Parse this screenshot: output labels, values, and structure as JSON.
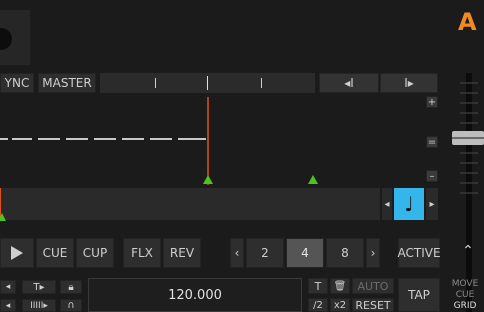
{
  "deck": {
    "letter": "A"
  },
  "top_row": {
    "sync_label": "YNC",
    "master_label": "MASTER"
  },
  "beatjump": {
    "back_glyph": "◂I",
    "fwd_glyph": "I▸"
  },
  "side": {
    "plus": "+",
    "equal": "=",
    "minus": "–"
  },
  "grid": {
    "prev": "◂",
    "next": "▸",
    "note_glyph": "♩"
  },
  "transport": {
    "cue_label": "CUE",
    "cup_label": "CUP",
    "flx_label": "FLX",
    "rev_label": "REV",
    "loop_prev": "‹",
    "loop_next": "›",
    "loop_values": [
      "2",
      "4",
      "8"
    ],
    "loop_selected": "4",
    "active_label": "ACTIVE",
    "expand_glyph": "⌃"
  },
  "bottom": {
    "bpm_value": "120.000",
    "half_label": "/2",
    "double_label": "x2",
    "auto_label": "AUTO",
    "reset_label": "RESET",
    "tap_label": "TAP",
    "move_line1": "MOVE",
    "move_line2": "CUE",
    "move_line3": "GRID"
  },
  "colors": {
    "accent": "#f08a24",
    "playhead": "#e0521c",
    "cue_marker": "#4cc41e",
    "note_button": "#35b6ea"
  }
}
